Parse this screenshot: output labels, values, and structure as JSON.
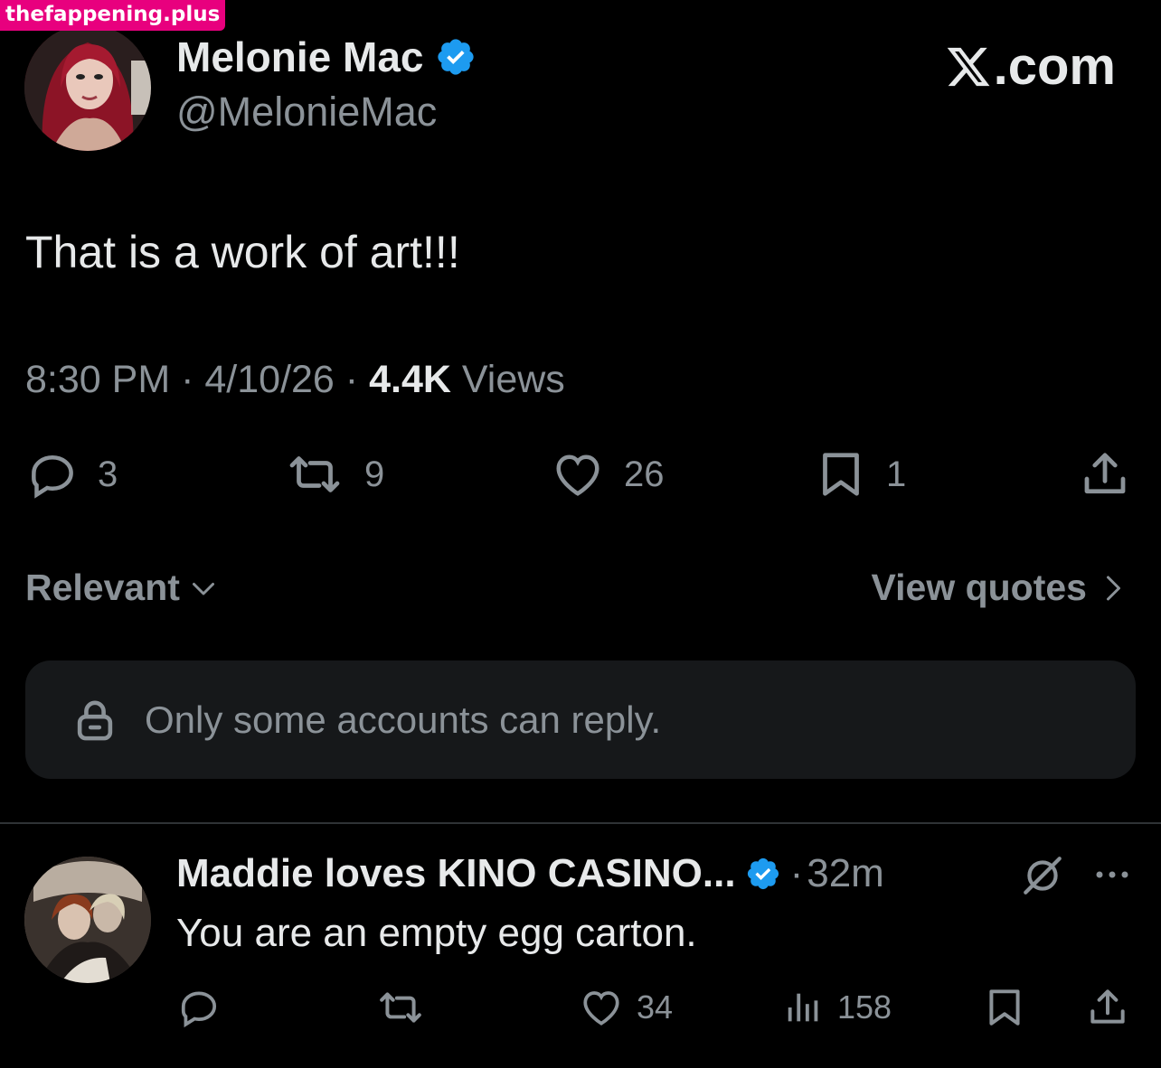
{
  "watermark": "thefappening.plus",
  "tweet": {
    "display_name": "Melonie Mac",
    "handle": "@MelonieMac",
    "brand": ".com",
    "text": "That is a work of art!!!",
    "time": "8:30 PM",
    "date": "4/10/26",
    "views_count": "4.4K",
    "views_label": "Views",
    "stats": {
      "replies": "3",
      "reposts": "9",
      "likes": "26",
      "bookmarks": "1"
    }
  },
  "sort": {
    "label": "Relevant"
  },
  "view_quotes": "View quotes",
  "reply_restriction": "Only some accounts can reply.",
  "reply": {
    "display_name": "Maddie loves KINO CASINO...",
    "time": "32m",
    "text": "You are an empty egg carton.",
    "stats": {
      "likes": "34",
      "views": "158"
    }
  },
  "colors": {
    "background": "#000000",
    "text": "#e7e9ea",
    "muted": "#8b9298",
    "verified": "#1d9bf0",
    "reply_box": "#16181a",
    "watermark": "#e8007e"
  }
}
